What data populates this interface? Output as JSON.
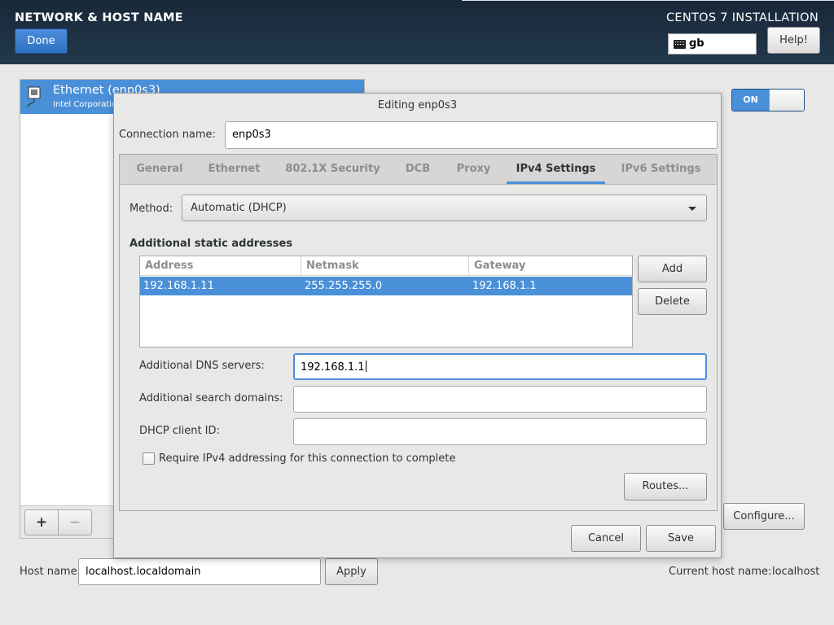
{
  "header": {
    "title": "NETWORK & HOST NAME",
    "product": "CENTOS 7 INSTALLATION",
    "done_label": "Done",
    "keyboard_layout": "gb",
    "help_label": "Help!"
  },
  "devices": {
    "items": [
      {
        "name": "Ethernet (enp0s3)",
        "subtitle": "Intel Corporation"
      }
    ],
    "add_label": "+",
    "remove_label": "−"
  },
  "device_panel": {
    "toggle_label": "ON",
    "toggle_state": "on",
    "configure_label": "Configure..."
  },
  "hostname": {
    "label": "Host name:",
    "value": "localhost.localdomain",
    "apply_label": "Apply",
    "current_label": "Current host name:",
    "current_value": "localhost"
  },
  "dialog": {
    "title": "Editing enp0s3",
    "connection_name_label": "Connection name:",
    "connection_name_value": "enp0s3",
    "tabs": [
      {
        "label": "General"
      },
      {
        "label": "Ethernet"
      },
      {
        "label": "802.1X Security"
      },
      {
        "label": "DCB"
      },
      {
        "label": "Proxy"
      },
      {
        "label": "IPv4 Settings"
      },
      {
        "label": "IPv6 Settings"
      }
    ],
    "active_tab": "IPv4 Settings",
    "method_label": "Method:",
    "method_value": "Automatic (DHCP)",
    "addresses_heading": "Additional static addresses",
    "columns": [
      "Address",
      "Netmask",
      "Gateway"
    ],
    "rows": [
      {
        "address": "192.168.1.11",
        "netmask": "255.255.255.0",
        "gateway": "192.168.1.1"
      }
    ],
    "add_label": "Add",
    "delete_label": "Delete",
    "dns_label": "Additional DNS servers:",
    "dns_value": "192.168.1.1",
    "search_label": "Additional search domains:",
    "search_value": "",
    "dhcp_label": "DHCP client ID:",
    "dhcp_value": "",
    "require_label": "Require IPv4 addressing for this connection to complete",
    "require_checked": false,
    "routes_label": "Routes...",
    "cancel_label": "Cancel",
    "save_label": "Save"
  },
  "colors": {
    "accent": "#4a90d9",
    "header_bg": "#1f3347",
    "window_bg": "#e8e8e7"
  }
}
